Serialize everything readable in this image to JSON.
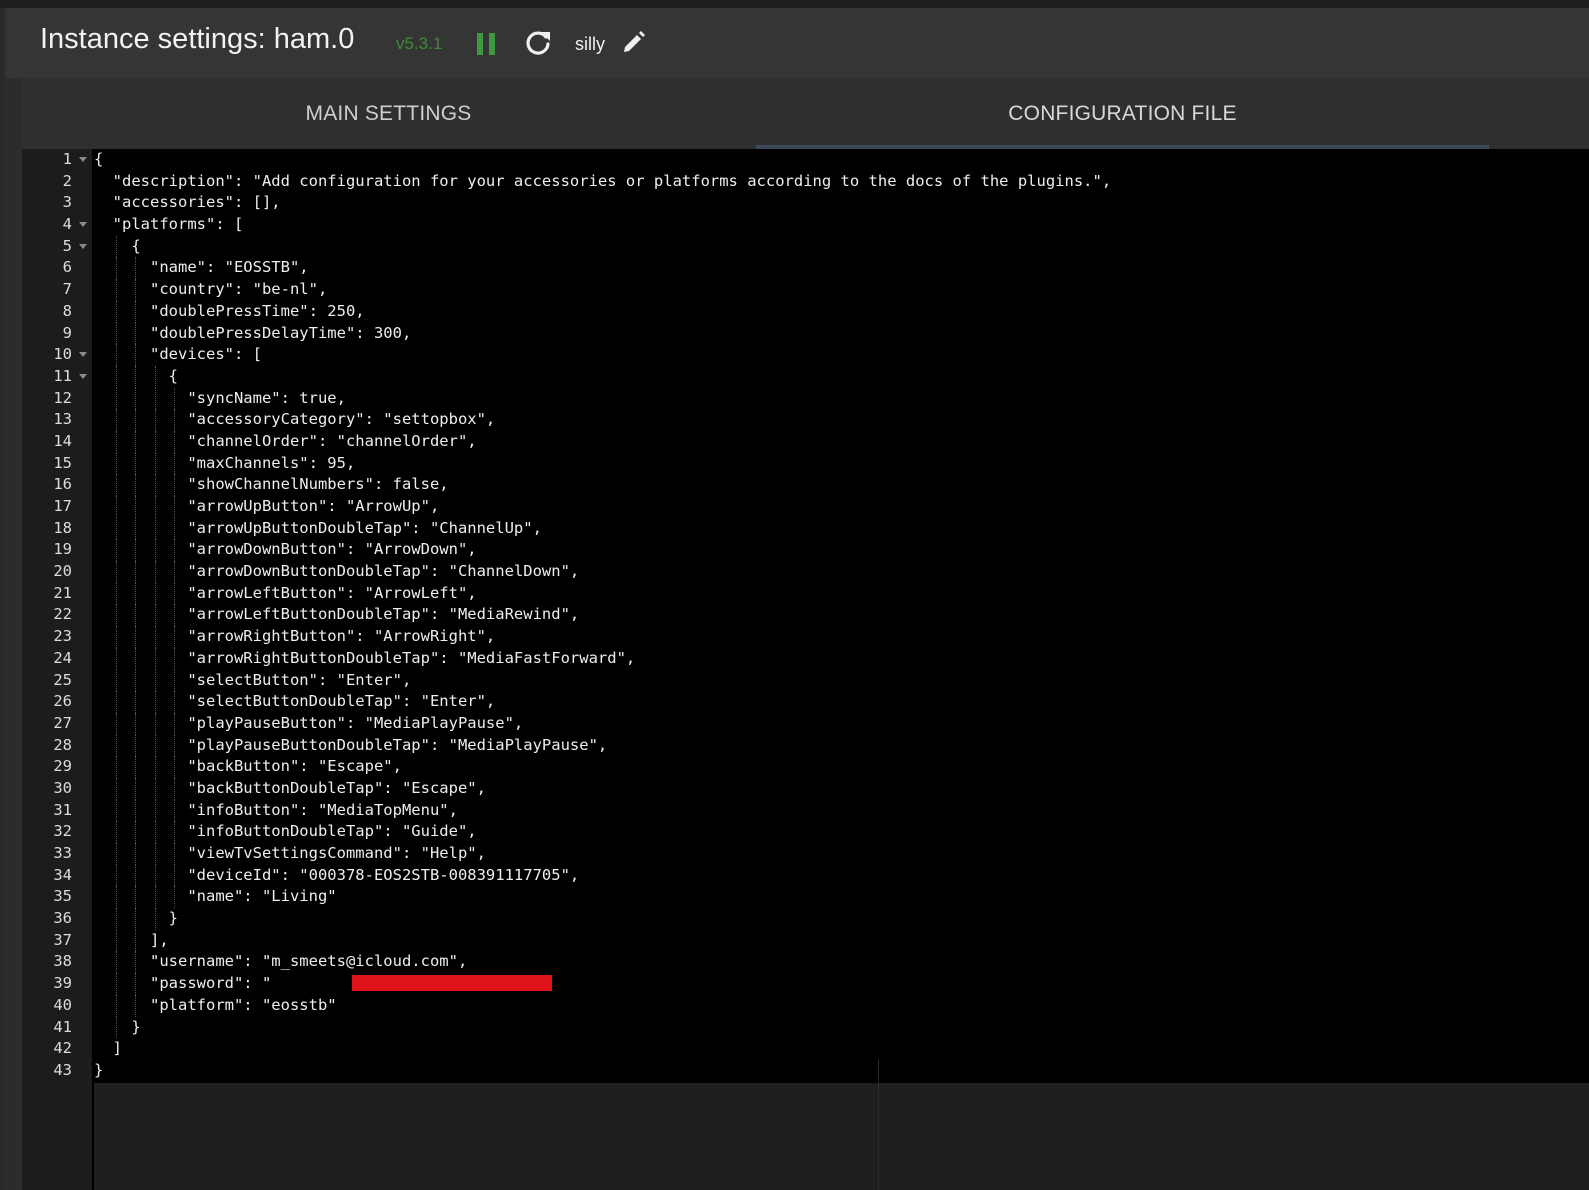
{
  "header": {
    "title": "Instance settings: ham.0",
    "version": "v5.3.1",
    "log_level": "silly",
    "icons": {
      "pause": "pause-icon",
      "reload": "reload-icon",
      "edit": "pencil-icon"
    },
    "colors": {
      "version": "#3f8a3a",
      "pause": "#3f9a3f"
    }
  },
  "tabs": [
    {
      "label": "MAIN SETTINGS",
      "active": false
    },
    {
      "label": "CONFIGURATION FILE",
      "active": true
    }
  ],
  "editor": {
    "lines": [
      {
        "n": "1",
        "text": "{",
        "fold": true,
        "indent": 0
      },
      {
        "n": "2",
        "text": "  \"description\": \"Add configuration for your accessories or platforms according to the docs of the plugins.\",",
        "fold": false,
        "indent": 1
      },
      {
        "n": "3",
        "text": "  \"accessories\": [],",
        "fold": false,
        "indent": 1
      },
      {
        "n": "4",
        "text": "  \"platforms\": [",
        "fold": true,
        "indent": 1
      },
      {
        "n": "5",
        "text": "    {",
        "fold": true,
        "indent": 2
      },
      {
        "n": "6",
        "text": "      \"name\": \"EOSSTB\",",
        "fold": false,
        "indent": 3
      },
      {
        "n": "7",
        "text": "      \"country\": \"be-nl\",",
        "fold": false,
        "indent": 3
      },
      {
        "n": "8",
        "text": "      \"doublePressTime\": 250,",
        "fold": false,
        "indent": 3
      },
      {
        "n": "9",
        "text": "      \"doublePressDelayTime\": 300,",
        "fold": false,
        "indent": 3
      },
      {
        "n": "10",
        "text": "      \"devices\": [",
        "fold": true,
        "indent": 3
      },
      {
        "n": "11",
        "text": "        {",
        "fold": true,
        "indent": 4
      },
      {
        "n": "12",
        "text": "          \"syncName\": true,",
        "fold": false,
        "indent": 5
      },
      {
        "n": "13",
        "text": "          \"accessoryCategory\": \"settopbox\",",
        "fold": false,
        "indent": 5
      },
      {
        "n": "14",
        "text": "          \"channelOrder\": \"channelOrder\",",
        "fold": false,
        "indent": 5
      },
      {
        "n": "15",
        "text": "          \"maxChannels\": 95,",
        "fold": false,
        "indent": 5
      },
      {
        "n": "16",
        "text": "          \"showChannelNumbers\": false,",
        "fold": false,
        "indent": 5
      },
      {
        "n": "17",
        "text": "          \"arrowUpButton\": \"ArrowUp\",",
        "fold": false,
        "indent": 5
      },
      {
        "n": "18",
        "text": "          \"arrowUpButtonDoubleTap\": \"ChannelUp\",",
        "fold": false,
        "indent": 5
      },
      {
        "n": "19",
        "text": "          \"arrowDownButton\": \"ArrowDown\",",
        "fold": false,
        "indent": 5
      },
      {
        "n": "20",
        "text": "          \"arrowDownButtonDoubleTap\": \"ChannelDown\",",
        "fold": false,
        "indent": 5
      },
      {
        "n": "21",
        "text": "          \"arrowLeftButton\": \"ArrowLeft\",",
        "fold": false,
        "indent": 5
      },
      {
        "n": "22",
        "text": "          \"arrowLeftButtonDoubleTap\": \"MediaRewind\",",
        "fold": false,
        "indent": 5
      },
      {
        "n": "23",
        "text": "          \"arrowRightButton\": \"ArrowRight\",",
        "fold": false,
        "indent": 5
      },
      {
        "n": "24",
        "text": "          \"arrowRightButtonDoubleTap\": \"MediaFastForward\",",
        "fold": false,
        "indent": 5
      },
      {
        "n": "25",
        "text": "          \"selectButton\": \"Enter\",",
        "fold": false,
        "indent": 5
      },
      {
        "n": "26",
        "text": "          \"selectButtonDoubleTap\": \"Enter\",",
        "fold": false,
        "indent": 5
      },
      {
        "n": "27",
        "text": "          \"playPauseButton\": \"MediaPlayPause\",",
        "fold": false,
        "indent": 5
      },
      {
        "n": "28",
        "text": "          \"playPauseButtonDoubleTap\": \"MediaPlayPause\",",
        "fold": false,
        "indent": 5
      },
      {
        "n": "29",
        "text": "          \"backButton\": \"Escape\",",
        "fold": false,
        "indent": 5
      },
      {
        "n": "30",
        "text": "          \"backButtonDoubleTap\": \"Escape\",",
        "fold": false,
        "indent": 5
      },
      {
        "n": "31",
        "text": "          \"infoButton\": \"MediaTopMenu\",",
        "fold": false,
        "indent": 5
      },
      {
        "n": "32",
        "text": "          \"infoButtonDoubleTap\": \"Guide\",",
        "fold": false,
        "indent": 5
      },
      {
        "n": "33",
        "text": "          \"viewTvSettingsCommand\": \"Help\",",
        "fold": false,
        "indent": 5
      },
      {
        "n": "34",
        "text": "          \"deviceId\": \"000378-EOS2STB-008391117705\",",
        "fold": false,
        "indent": 5
      },
      {
        "n": "35",
        "text": "          \"name\": \"Living\"",
        "fold": false,
        "indent": 5
      },
      {
        "n": "36",
        "text": "        }",
        "fold": false,
        "indent": 4
      },
      {
        "n": "37",
        "text": "      ],",
        "fold": false,
        "indent": 3
      },
      {
        "n": "38",
        "text": "      \"username\": \"m_smeets@icloud.com\",",
        "fold": false,
        "indent": 3
      },
      {
        "n": "39",
        "text": "      \"password\": \"                    \",",
        "fold": false,
        "indent": 3
      },
      {
        "n": "40",
        "text": "      \"platform\": \"eosstb\"",
        "fold": false,
        "indent": 3
      },
      {
        "n": "41",
        "text": "    }",
        "fold": false,
        "indent": 2
      },
      {
        "n": "42",
        "text": "  ]",
        "fold": false,
        "indent": 1
      },
      {
        "n": "43",
        "text": "}",
        "fold": false,
        "indent": 0
      }
    ]
  }
}
